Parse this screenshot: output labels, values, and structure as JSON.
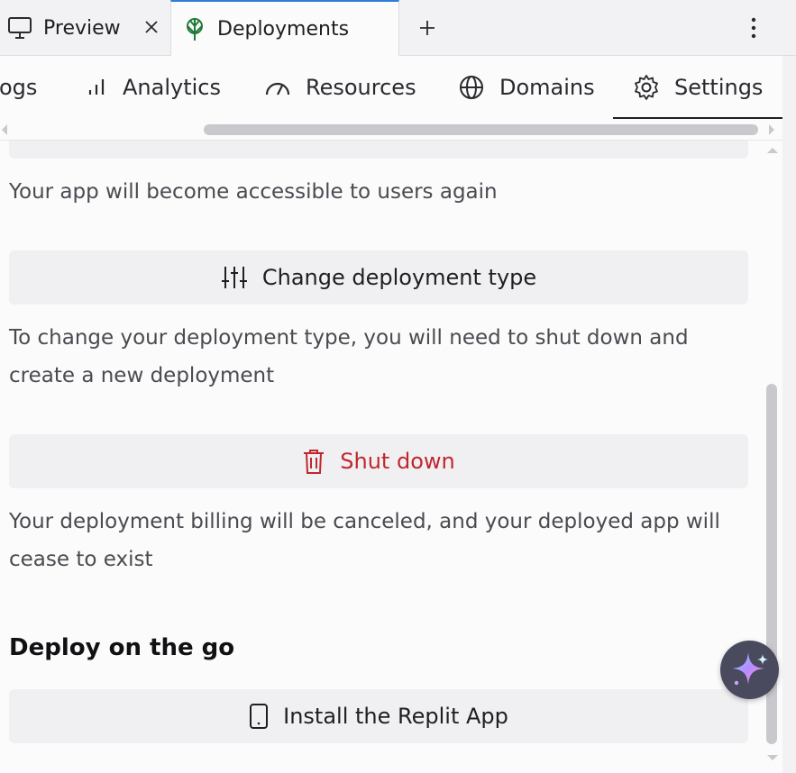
{
  "tabs": {
    "preview_label": "Preview",
    "deployments_label": "Deployments"
  },
  "subnav": {
    "logs": "Logs",
    "analytics": "Analytics",
    "resources": "Resources",
    "domains": "Domains",
    "settings": "Settings"
  },
  "content": {
    "restart_desc": "Your app will become accessible to users again",
    "change_type_label": "Change deployment type",
    "change_type_desc": "To change your deployment type, you will need to shut down and create a new deployment",
    "shutdown_label": "Shut down",
    "shutdown_desc": "Your deployment billing will be canceled, and your deployed app will cease to exist",
    "go_title": "Deploy on the go",
    "install_label": "Install the Replit App"
  },
  "colors": {
    "accent": "#2f7bd8",
    "danger": "#c0272d",
    "deploy_icon": "#1f7a3a"
  },
  "icons": [
    "monitor-icon",
    "close-icon",
    "deployments-icon",
    "plus-icon",
    "more-vertical-icon",
    "analytics-icon",
    "gauge-icon",
    "globe-icon",
    "gear-icon",
    "sliders-icon",
    "trash-icon",
    "phone-icon",
    "sparkle-icon"
  ]
}
